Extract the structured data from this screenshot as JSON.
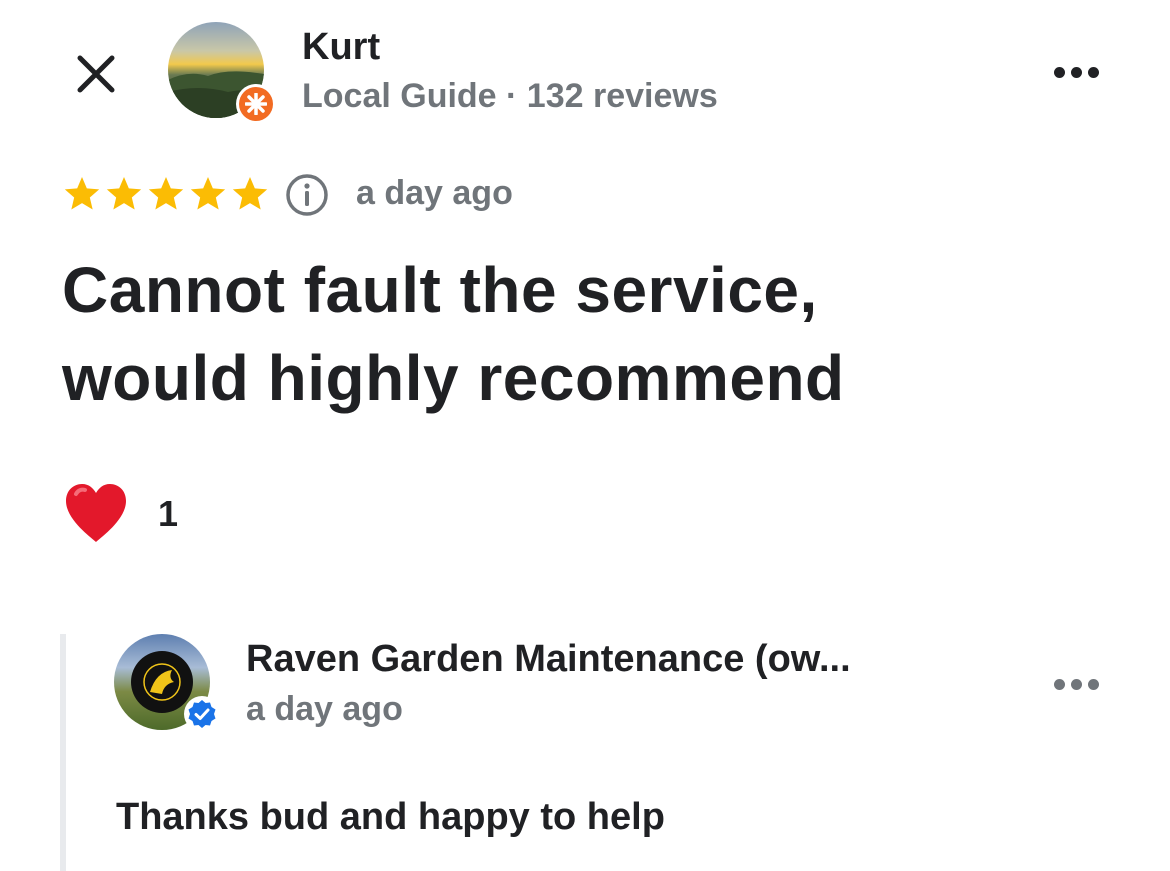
{
  "header": {
    "close_icon": "close-icon",
    "more_icon": "more-horizontal-icon"
  },
  "reviewer": {
    "name": "Kurt",
    "meta": "Local Guide · 132 reviews",
    "badge_icon": "local-guide-star-icon",
    "badge_color": "#f26b22"
  },
  "review": {
    "rating": 5,
    "rating_max": 5,
    "star_color": "#fbbc04",
    "info_icon": "info-icon",
    "date": "a day ago",
    "text_line1": "Cannot fault the service,",
    "text_line2": "would highly recommend"
  },
  "reactions": {
    "icon": "heart-icon",
    "count": "1"
  },
  "owner_reply": {
    "name": "Raven Garden Maintenance (ow...",
    "date": "a day ago",
    "verified_icon": "verified-check-icon",
    "verified_color": "#1a73e8",
    "text": "Thanks bud and happy to help"
  }
}
